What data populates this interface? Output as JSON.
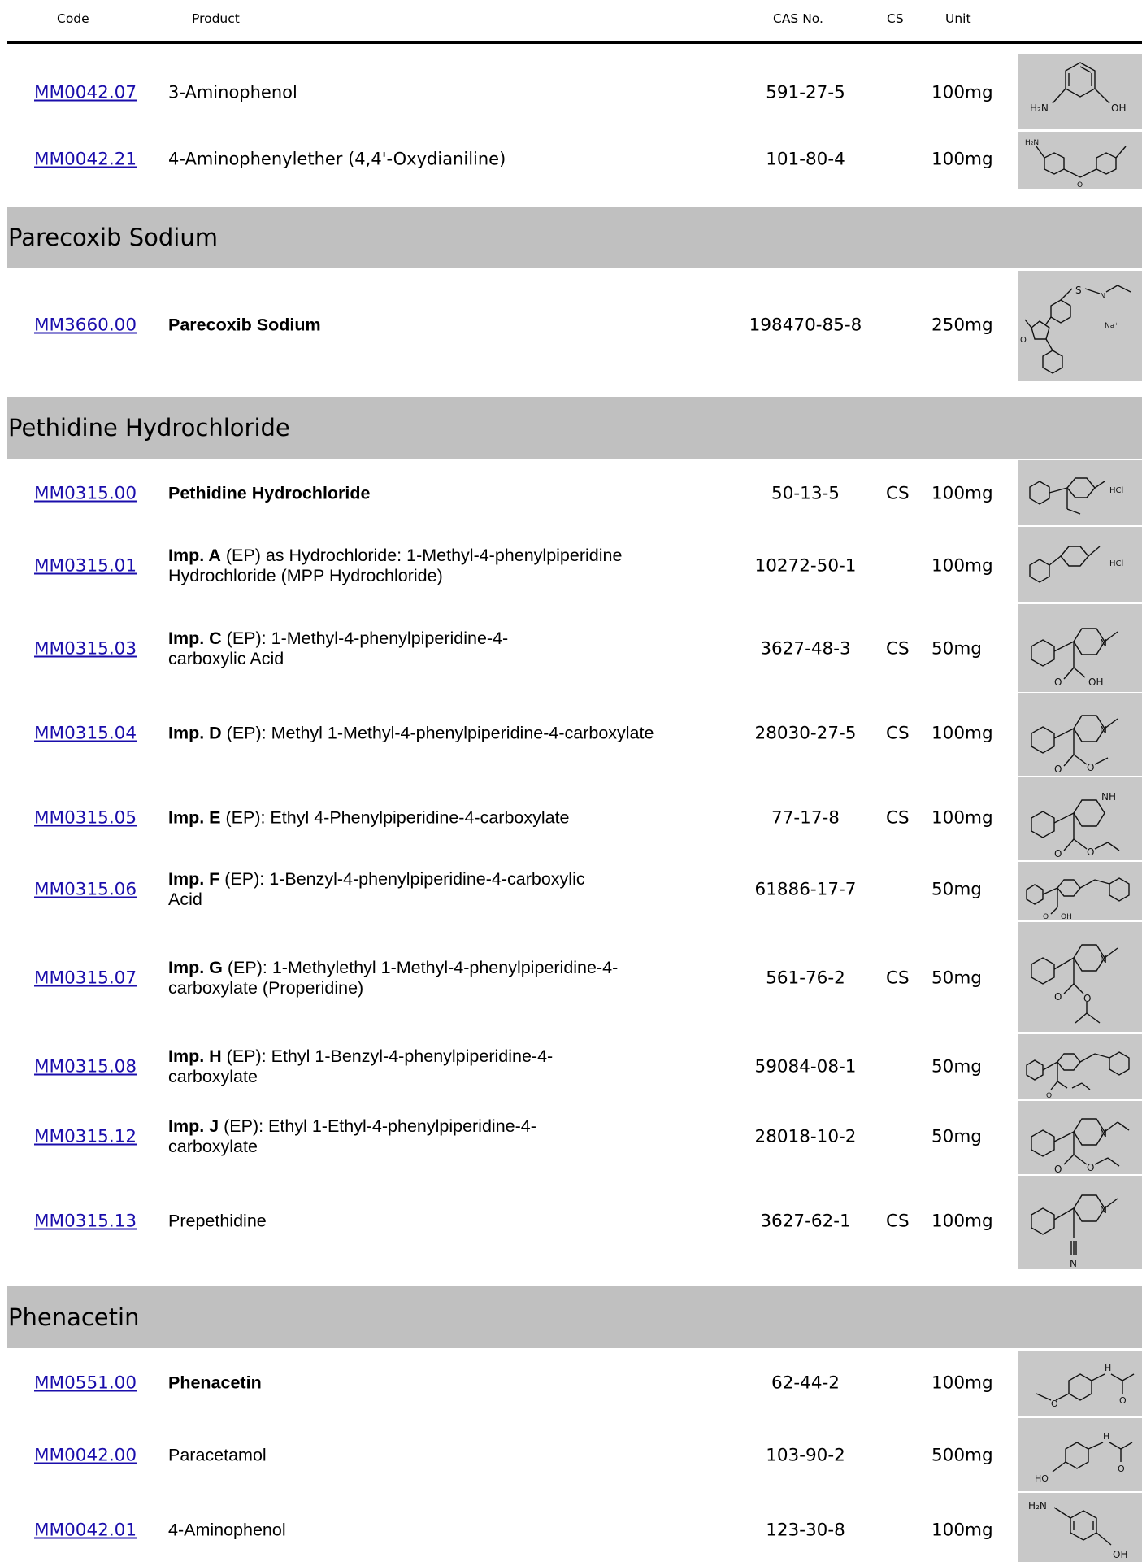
{
  "header": {
    "code": "Code",
    "product": "Product",
    "cas": "CAS No.",
    "cs": "CS",
    "unit": "Unit"
  },
  "sections": {
    "parecoxib": "Parecoxib Sodium",
    "pethidine": "Pethidine Hydrochloride",
    "phenacetin": "Phenacetin"
  },
  "rows": {
    "r0": {
      "code": "MM0042.07",
      "lead": "",
      "name": "3-Aminophenol",
      "cas": "591-27-5",
      "cs": "",
      "unit": "100mg",
      "structure_icon": "3-aminophenol-structure"
    },
    "r1": {
      "code": "MM0042.21",
      "lead": "",
      "name": "4-Aminophenylether (4,4'-Oxydianiline)",
      "cas": "101-80-4",
      "cs": "",
      "unit": "100mg",
      "structure_icon": "oxydianiline-structure"
    },
    "r2": {
      "code": "MM3660.00",
      "lead": "Parecoxib Sodium",
      "name": "",
      "cas": "198470-85-8",
      "cs": "",
      "unit": "250mg",
      "structure_icon": "parecoxib-sodium-structure"
    },
    "r3": {
      "code": "MM0315.00",
      "lead": "Pethidine Hydrochloride",
      "name": "",
      "cas": "50-13-5",
      "cs": "CS",
      "unit": "100mg",
      "structure_icon": "pethidine-hcl-structure"
    },
    "r4": {
      "code": "MM0315.01",
      "lead": "Imp. A",
      "name": " (EP) as Hydrochloride: 1-Methyl-4-phenylpiperidine Hydrochloride (MPP Hydrochloride)",
      "cas": "10272-50-1",
      "cs": "",
      "unit": "100mg",
      "structure_icon": "mpp-hcl-structure"
    },
    "r5": {
      "code": "MM0315.03",
      "lead": "Imp. C",
      "name": " (EP): 1-Methyl-4-phenylpiperidine-4-carboxylic Acid",
      "cas": "3627-48-3",
      "cs": "CS",
      "unit": "50mg",
      "structure_icon": "imp-c-structure"
    },
    "r6": {
      "code": "MM0315.04",
      "lead": "Imp. D",
      "name": " (EP): Methyl 1-Methyl-4-phenylpiperidine-4-carboxylate",
      "cas": "28030-27-5",
      "cs": "CS",
      "unit": "100mg",
      "structure_icon": "imp-d-structure"
    },
    "r7": {
      "code": "MM0315.05",
      "lead": "Imp. E",
      "name": " (EP): Ethyl 4-Phenylpiperidine-4-carboxylate",
      "cas": "77-17-8",
      "cs": "CS",
      "unit": "100mg",
      "structure_icon": "imp-e-structure"
    },
    "r8": {
      "code": "MM0315.06",
      "lead": "Imp. F",
      "name": " (EP): 1-Benzyl-4-phenylpiperidine-4-carboxylic Acid",
      "cas": "61886-17-7",
      "cs": "",
      "unit": "50mg",
      "structure_icon": "imp-f-structure"
    },
    "r9": {
      "code": "MM0315.07",
      "lead": "Imp. G",
      "name": " (EP): 1-Methylethyl 1-Methyl-4-phenylpiperidine-4-carboxylate (Properidine)",
      "cas": "561-76-2",
      "cs": "CS",
      "unit": "50mg",
      "structure_icon": "imp-g-structure"
    },
    "r10": {
      "code": "MM0315.08",
      "lead": "Imp. H",
      "name": " (EP): Ethyl 1-Benzyl-4-phenylpiperidine-4-carboxylate",
      "cas": "59084-08-1",
      "cs": "",
      "unit": "50mg",
      "structure_icon": "imp-h-structure"
    },
    "r11": {
      "code": "MM0315.12",
      "lead": "Imp. J",
      "name": " (EP): Ethyl 1-Ethyl-4-phenylpiperidine-4-carboxylate",
      "cas": "28018-10-2",
      "cs": "",
      "unit": "50mg",
      "structure_icon": "imp-j-structure"
    },
    "r12": {
      "code": "MM0315.13",
      "lead": "",
      "name": "Prepethidine",
      "cas": "3627-62-1",
      "cs": "CS",
      "unit": "100mg",
      "structure_icon": "prepethidine-structure"
    },
    "r13": {
      "code": "MM0551.00",
      "lead": "Phenacetin",
      "name": "",
      "cas": "62-44-2",
      "cs": "",
      "unit": "100mg",
      "structure_icon": "phenacetin-structure"
    },
    "r14": {
      "code": "MM0042.00",
      "lead": "",
      "name": "Paracetamol",
      "cas": "103-90-2",
      "cs": "",
      "unit": "500mg",
      "structure_icon": "paracetamol-structure"
    },
    "r15": {
      "code": "MM0042.01",
      "lead": "",
      "name": "4-Aminophenol",
      "cas": "123-30-8",
      "cs": "",
      "unit": "100mg",
      "structure_icon": "4-aminophenol-structure"
    }
  },
  "atom_labels": {
    "h2n": "H₂N",
    "oh": "OH",
    "o": "O",
    "n": "N",
    "nh": "NH",
    "h": "H",
    "hcl": "HCl",
    "na": "Na⁺",
    "s": "S",
    "ho": "HO"
  }
}
